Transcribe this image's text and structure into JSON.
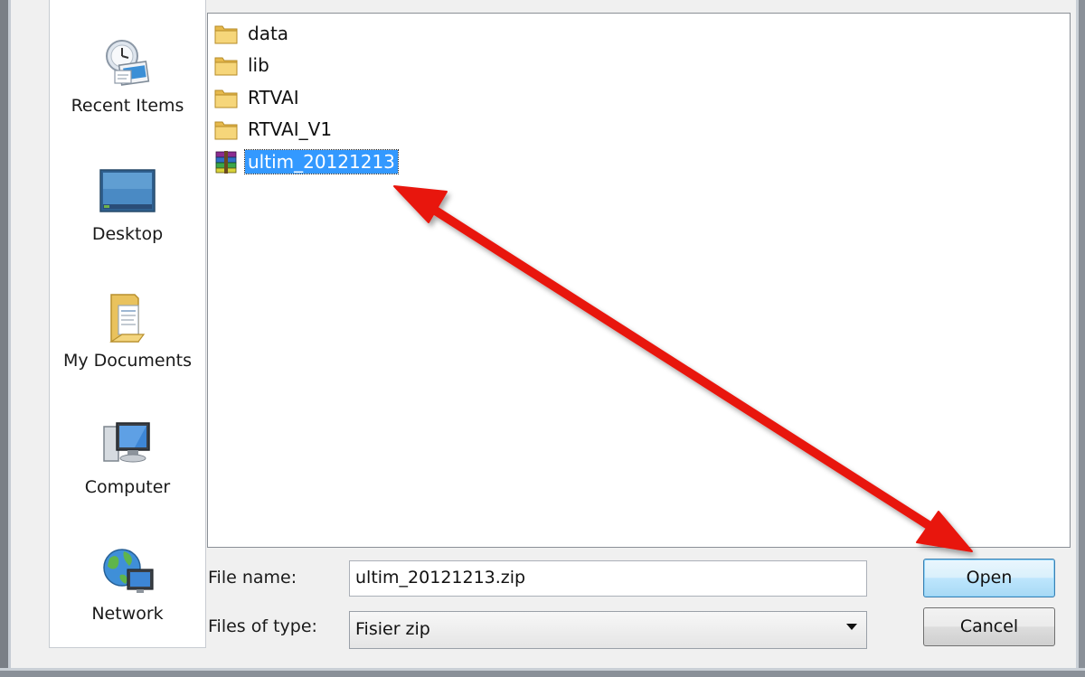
{
  "places": [
    {
      "label": "Recent Items",
      "icon": "recent-items-icon"
    },
    {
      "label": "Desktop",
      "icon": "desktop-icon"
    },
    {
      "label": "My Documents",
      "icon": "my-documents-icon"
    },
    {
      "label": "Computer",
      "icon": "computer-icon"
    },
    {
      "label": "Network",
      "icon": "network-icon"
    }
  ],
  "files": [
    {
      "name": "data",
      "type": "folder"
    },
    {
      "name": "lib",
      "type": "folder"
    },
    {
      "name": "RTVAI",
      "type": "folder"
    },
    {
      "name": "RTVAI_V1",
      "type": "folder"
    },
    {
      "name": "ultim_20121213",
      "type": "zip-archive",
      "selected": true
    }
  ],
  "form": {
    "file_name_label": "File name:",
    "file_name_value": "ultim_20121213.zip",
    "files_of_type_label": "Files of type:",
    "files_of_type_value": "Fisier zip"
  },
  "buttons": {
    "open": "Open",
    "cancel": "Cancel"
  },
  "colors": {
    "selection": "#3399ff",
    "annotation_arrow": "#e8140c"
  }
}
